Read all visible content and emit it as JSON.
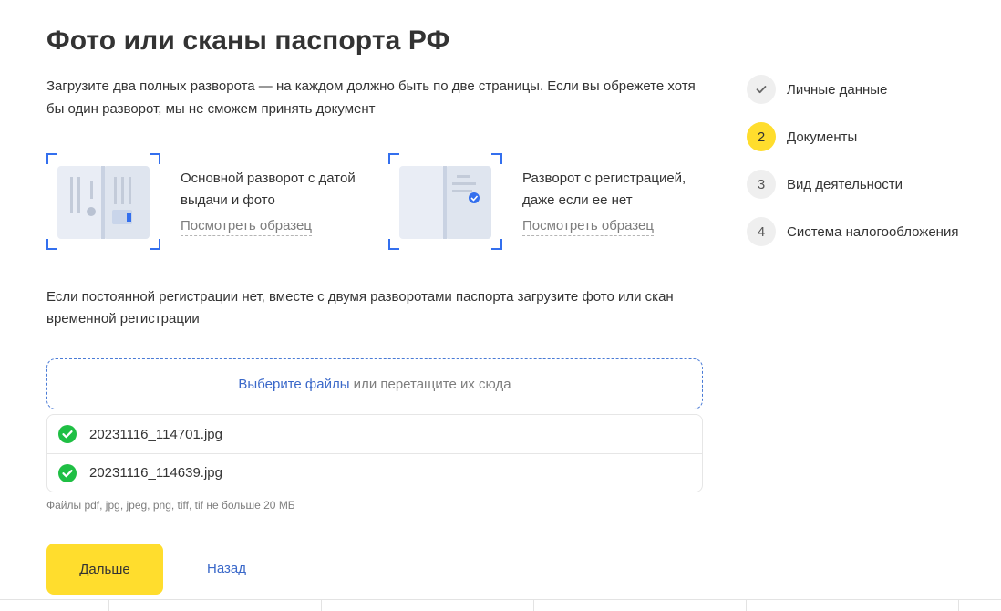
{
  "page": {
    "title": "Фото или сканы паспорта РФ",
    "intro": "Загрузите два полных разворота — на каждом должно быть по две страницы. Если вы обрежете хотя бы один разворот, мы не сможем принять документ"
  },
  "samples": [
    {
      "icon": "passport-main-spread-icon",
      "text": "Основной разворот с датой выдачи и фото",
      "link": "Посмотреть образец"
    },
    {
      "icon": "passport-registration-spread-icon",
      "text": "Разворот с регистрацией, даже если ее нет",
      "link": "Посмотреть образец"
    }
  ],
  "note": "Если постоянной регистрации нет, вместе с двумя разворотами паспорта загрузите фото или скан временной регистрации",
  "upload": {
    "choose_label": "Выберите файлы",
    "drop_label": " или перетащите их сюда",
    "files": [
      {
        "name": "20231116_114701.jpg",
        "status_icon": "check-circle-icon"
      },
      {
        "name": "20231116_114639.jpg",
        "status_icon": "check-circle-icon"
      }
    ],
    "hint": "Файлы pdf, jpg, jpeg, png, tiff, tif не больше 20 МБ"
  },
  "actions": {
    "next_label": "Дальше",
    "back_label": "Назад"
  },
  "steps": [
    {
      "marker": "✓",
      "label": "Личные данные",
      "state": "done"
    },
    {
      "marker": "2",
      "label": "Документы",
      "state": "active"
    },
    {
      "marker": "3",
      "label": "Вид деятельности",
      "state": "pending"
    },
    {
      "marker": "4",
      "label": "Система налогообложения",
      "state": "pending"
    }
  ],
  "colors": {
    "accent_yellow": "#ffdd2d",
    "link_blue": "#3a68c9",
    "success_green": "#1fbf44",
    "frame_blue": "#336fee"
  }
}
